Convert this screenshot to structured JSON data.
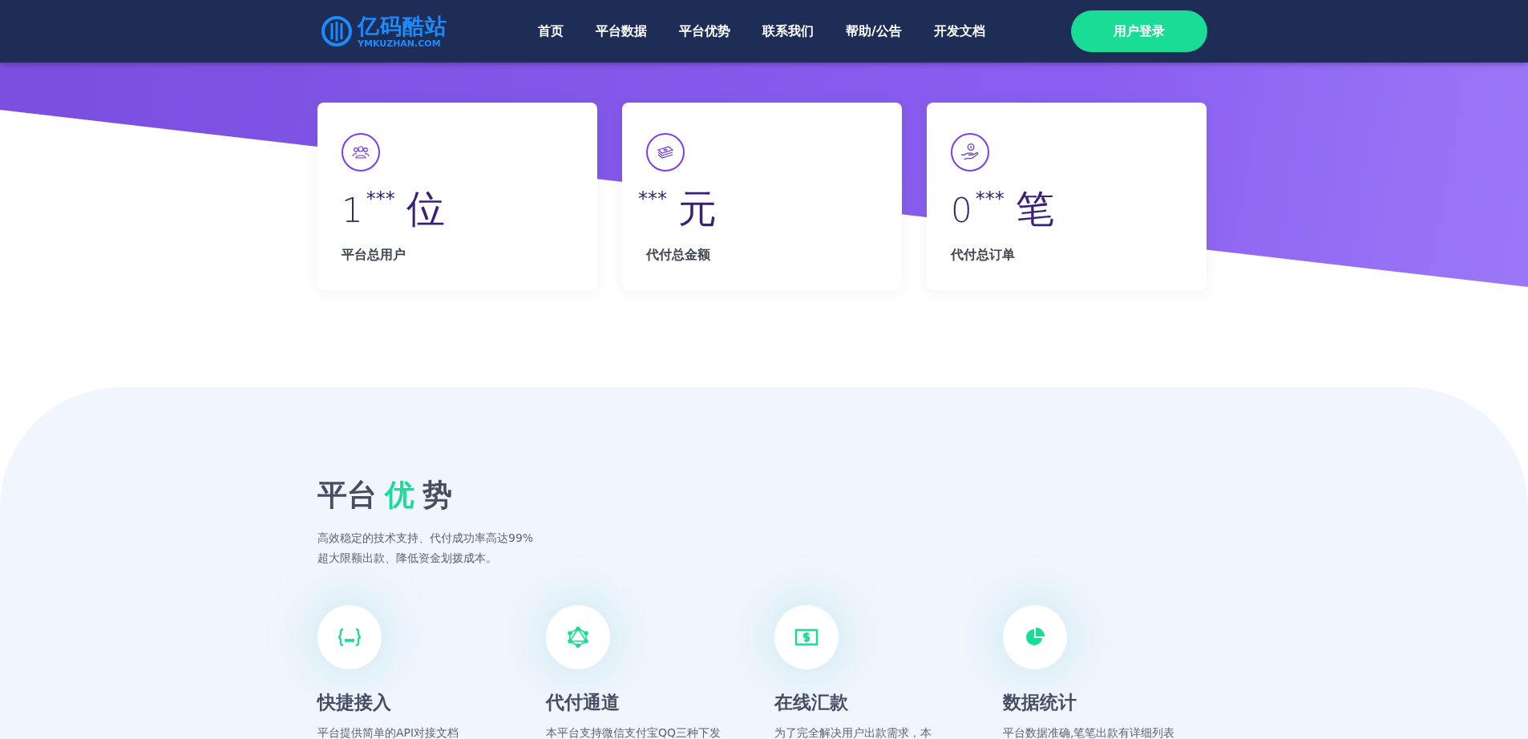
{
  "header": {
    "logo": {
      "name": "亿码酷站",
      "domain": "YMKUZHAN.COM"
    },
    "nav": [
      {
        "label": "首页"
      },
      {
        "label": "平台数据"
      },
      {
        "label": "平台优势"
      },
      {
        "label": "联系我们"
      },
      {
        "label": "帮助/公告"
      },
      {
        "label": "开发文档"
      }
    ],
    "login_button": "用户登录"
  },
  "stats": [
    {
      "kind": "users",
      "value": "1",
      "masked": "***",
      "unit": "位",
      "label": "平台总用户"
    },
    {
      "kind": "money",
      "masked": "***",
      "unit": "元",
      "label": "代付总金额"
    },
    {
      "kind": "hand",
      "value": "0",
      "masked": "***",
      "unit": "笔",
      "label": "代付总订单"
    }
  ],
  "advantages": {
    "title": [
      {
        "text": "平台",
        "highlight": false
      },
      {
        "text": "优",
        "highlight": true
      },
      {
        "text": "势",
        "highlight": false
      }
    ],
    "subtitle": [
      "高效稳定的技术支持、代付成功率高达99%",
      "超大限额出款、降低资金划拨成本。"
    ],
    "features": [
      {
        "kind": "braces",
        "title": "快捷接入",
        "text": "平台提供简单的API对接文档"
      },
      {
        "kind": "graph",
        "title": "代付通道",
        "text": "本平台支持微信支付宝QQ三种下发"
      },
      {
        "kind": "dollar",
        "title": "在线汇款",
        "text": "为了完全解决用户出款需求，本"
      },
      {
        "kind": "pie",
        "title": "数据统计",
        "text": "平台数据准确,笔笔出款有详细列表"
      }
    ]
  }
}
